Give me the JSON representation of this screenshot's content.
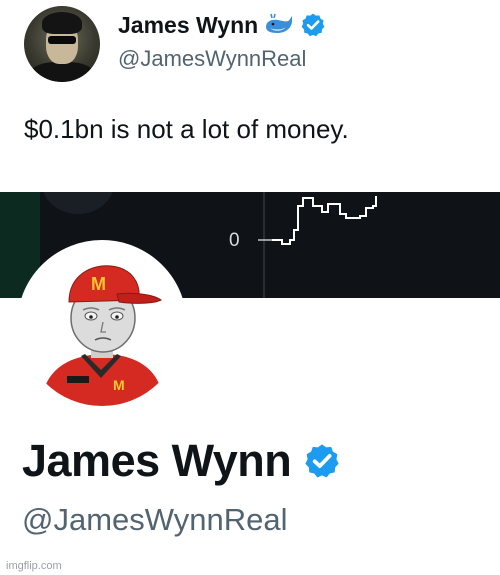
{
  "tweet": {
    "name": "James Wynn",
    "handle": "@JamesWynnReal",
    "text": "$0.1bn is not a lot of money.",
    "avatar_icon": "profile-photo-sunglasses",
    "name_badges": [
      "whale-icon",
      "verified-badge-icon"
    ]
  },
  "chart": {
    "zero_label": "0",
    "line_color": "#ffffff",
    "background": "#0f1318"
  },
  "profile": {
    "name": "James Wynn",
    "handle": "@JamesWynnReal",
    "avatar_icon": "wojak-mcdonalds-worker",
    "badge_icon": "verified-badge-icon"
  },
  "colors": {
    "verified": "#1d9bf0",
    "handle_text": "#536471",
    "mcdonalds_red": "#d42a22",
    "mcdonalds_yellow": "#ffc72c"
  },
  "watermark": "imgflip.com"
}
